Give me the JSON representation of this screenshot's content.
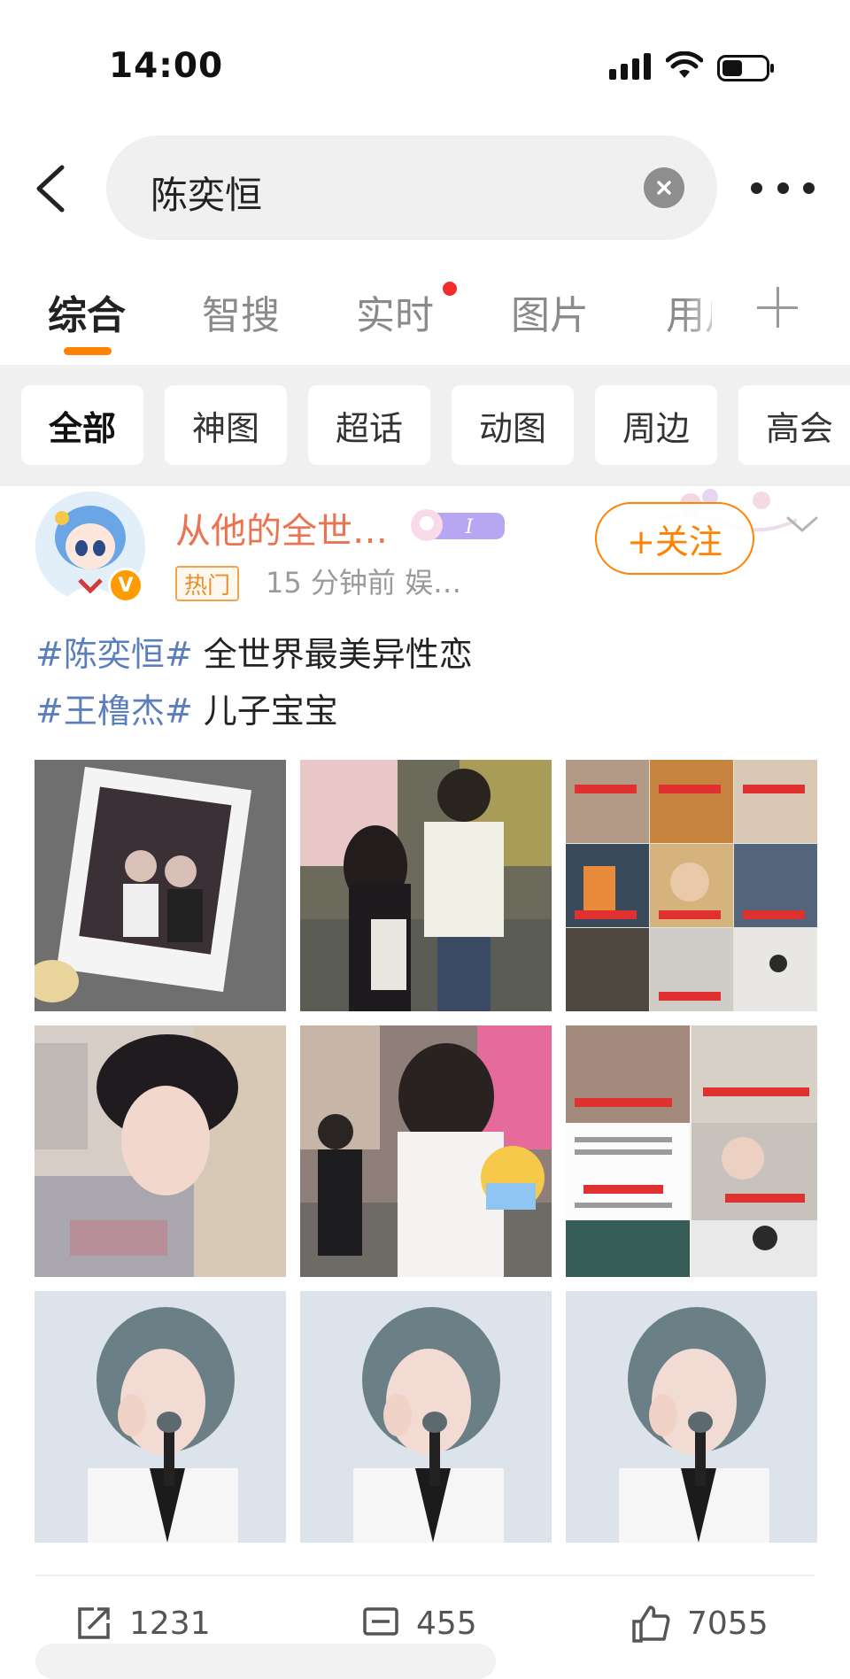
{
  "status_bar": {
    "time": "14:00"
  },
  "search": {
    "query": "陈奕恒"
  },
  "tabs": [
    {
      "label": "综合"
    },
    {
      "label": "智搜"
    },
    {
      "label": "实时"
    },
    {
      "label": "图片"
    },
    {
      "label": "用户"
    }
  ],
  "filters": [
    "全部",
    "神图",
    "超话",
    "动图",
    "周边",
    "高会"
  ],
  "post": {
    "username": "从他的全世…",
    "hot_label": "热门",
    "meta": "15 分钟前  娱…",
    "follow_label": "+关注",
    "line1_tag": "#陈奕恒#",
    "line1_text": " 全世界最美异性恋",
    "line2_tag": "#王橹杰#",
    "line2_text": " 儿子宝宝",
    "repost_count": "1231",
    "comment_count": "455",
    "like_count": "7055"
  },
  "colors": {
    "accent": "#ff8200",
    "username": "#eb7350",
    "hashtag": "#5b7fbd",
    "notification_dot": "#f42b2b"
  }
}
